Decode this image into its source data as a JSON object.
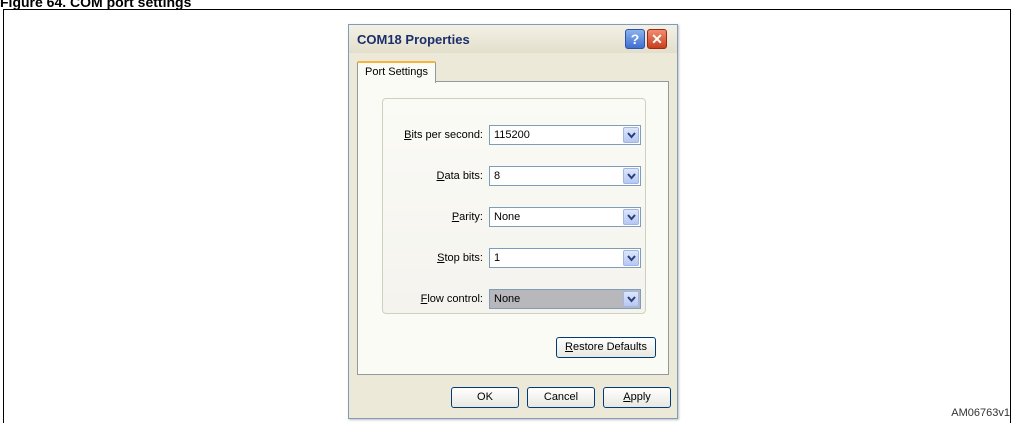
{
  "figure": {
    "heading": "Figure 64. COM port settings",
    "id_label": "AM06763v1"
  },
  "dialog": {
    "title": "COM18 Properties",
    "help_glyph": "?",
    "close_glyph": "✕",
    "tabs": [
      {
        "label": "Port Settings",
        "selected": true
      }
    ],
    "settings": [
      {
        "mnemonic": "B",
        "rest": "its per second:",
        "value": "115200"
      },
      {
        "mnemonic": "D",
        "rest": "ata bits:",
        "value": "8"
      },
      {
        "mnemonic": "P",
        "rest": "arity:",
        "value": "None"
      },
      {
        "mnemonic": "S",
        "rest": "top bits:",
        "value": "1"
      },
      {
        "mnemonic": "F",
        "rest": "low control:",
        "value": "None"
      }
    ],
    "restore_button": {
      "mnemonic": "R",
      "rest": "estore Defaults"
    },
    "ok_label": "OK",
    "cancel_label": "Cancel",
    "apply_button": {
      "mnemonic": "A",
      "rest": "pply"
    }
  },
  "colors": {
    "title_text": "#1c2f6a",
    "tab_highlight": "#f5b53c",
    "close_button": "#c74020",
    "help_button": "#3f6fd0"
  },
  "icons": {
    "help": "question-mark",
    "close": "x-close",
    "dropdown": "chevron-down"
  }
}
